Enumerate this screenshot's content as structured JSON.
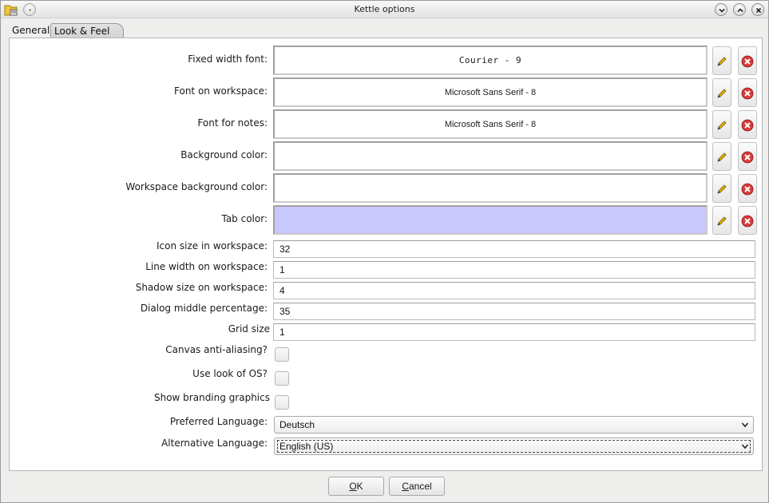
{
  "window": {
    "title": "Kettle options"
  },
  "tabs": [
    {
      "label": "General",
      "active": false
    },
    {
      "label": "Look & Feel",
      "active": true
    }
  ],
  "font_rows": [
    {
      "label": "Fixed width font:",
      "value": "Courier - 9",
      "style": "mono"
    },
    {
      "label": "Font on workspace:",
      "value": "Microsoft Sans Serif - 8",
      "style": "sans"
    },
    {
      "label": "Font for notes:",
      "value": "Microsoft Sans Serif - 8",
      "style": "sans"
    },
    {
      "label": "Background color:",
      "value": "",
      "swatch": "#ffffff"
    },
    {
      "label": "Workspace background color:",
      "value": "",
      "swatch": "#ffffff"
    },
    {
      "label": "Tab color:",
      "value": "",
      "swatch": "#c8c8ff"
    }
  ],
  "text_fields": [
    {
      "label": "Icon size in workspace:",
      "value": "32"
    },
    {
      "label": "Line width on workspace:",
      "value": "1"
    },
    {
      "label": "Shadow size on workspace:",
      "value": "4"
    },
    {
      "label": "Dialog middle percentage:",
      "value": "35"
    },
    {
      "label": "Grid size",
      "value": "1"
    }
  ],
  "checkboxes": [
    {
      "label": "Canvas anti-aliasing?",
      "checked": false
    },
    {
      "label": "Use look of OS?",
      "checked": false
    },
    {
      "label": "Show branding graphics",
      "checked": false
    }
  ],
  "selects": [
    {
      "label": "Preferred Language:",
      "value": "Deutsch"
    },
    {
      "label": "Alternative Language:",
      "value": "English (US)"
    }
  ],
  "buttons": {
    "ok": {
      "mnemonic": "O",
      "rest": "K"
    },
    "cancel": {
      "mnemonic": "C",
      "rest": "ancel"
    }
  },
  "icons": {
    "edit": "pencil-icon",
    "clear": "delete-icon",
    "app": "kettle-app-icon"
  },
  "colors": {
    "tab_color_swatch": "#c8c8ff",
    "delete_red": "#d83a3a",
    "pencil_yellow": "#e8b600"
  }
}
